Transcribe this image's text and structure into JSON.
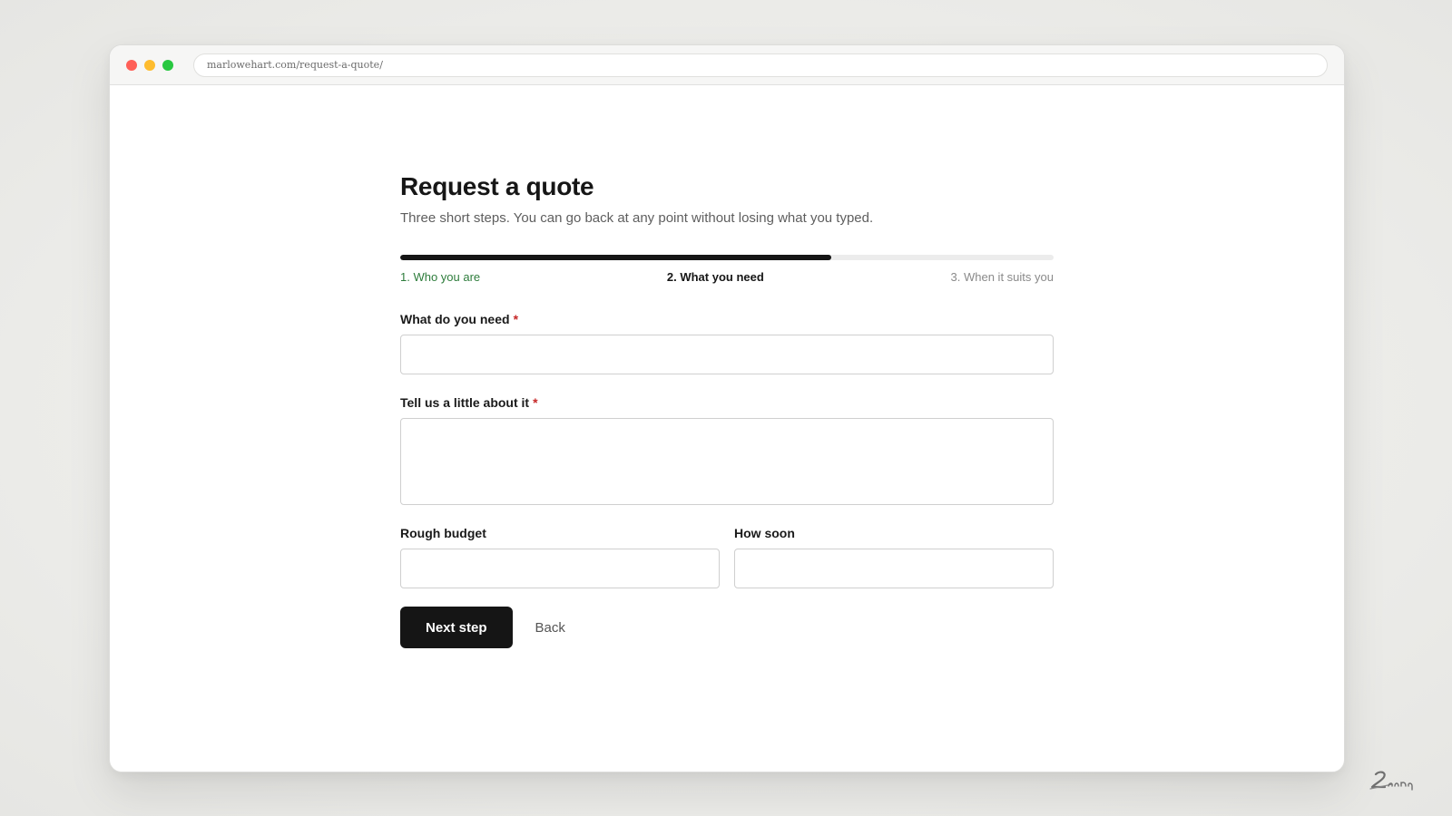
{
  "browser": {
    "url": "marlowehart.com/request-a-quote/"
  },
  "form": {
    "title": "Request a quote",
    "subtitle": "Three short steps. You can go back at any point without losing what you typed.",
    "progress_fraction": 0.66,
    "steps": [
      {
        "label": "1. Who you are",
        "state": "done"
      },
      {
        "label": "2. What you need",
        "state": "current"
      },
      {
        "label": "3. When it suits you",
        "state": "next"
      }
    ],
    "fields": {
      "need": {
        "label": "What do you need",
        "required_mark": "*",
        "value": ""
      },
      "about": {
        "label": "Tell us a little about it",
        "required_mark": "*",
        "value": ""
      },
      "budget": {
        "label": "Rough budget",
        "value": ""
      },
      "soon": {
        "label": "How soon",
        "value": ""
      }
    },
    "next_label": "Next step",
    "back_label": "Back"
  },
  "colors": {
    "primary": "#151515",
    "step_done": "#2e7d3c",
    "required": "#c62828"
  }
}
